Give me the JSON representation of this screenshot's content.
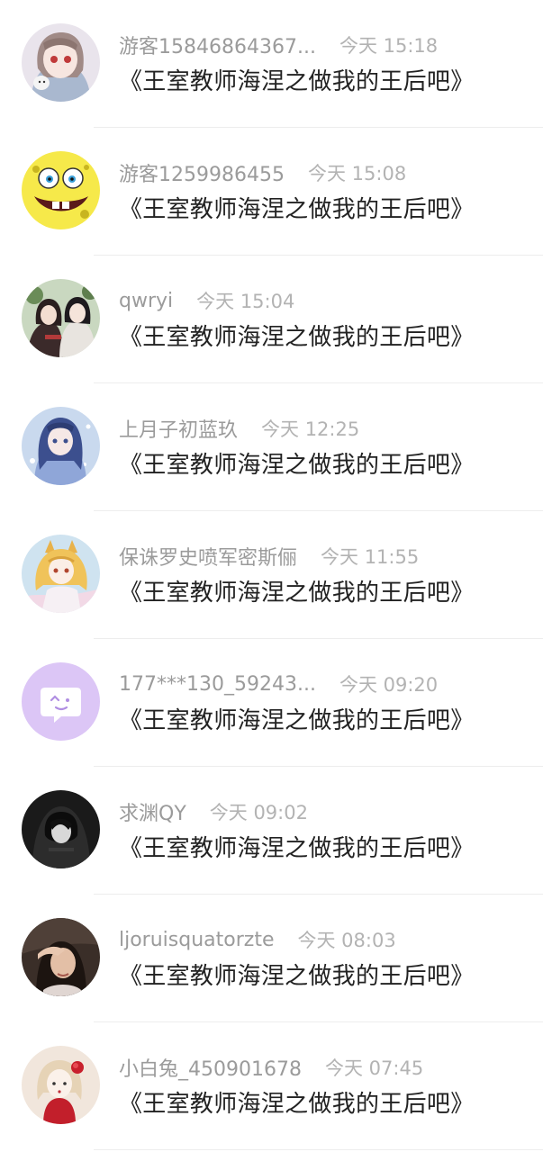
{
  "comments": [
    {
      "username": "游客15846864367...",
      "time": "今天 15:18",
      "content": "《王室教师海涅之做我的王后吧》",
      "avatar_icon": "anime-girl-avatar-icon"
    },
    {
      "username": "游客1259986455",
      "time": "今天 15:08",
      "content": "《王室教师海涅之做我的王后吧》",
      "avatar_icon": "spongebob-avatar-icon"
    },
    {
      "username": "qwryi",
      "time": "今天 15:04",
      "content": "《王室教师海涅之做我的王后吧》",
      "avatar_icon": "two-characters-avatar-icon"
    },
    {
      "username": "上月子初蓝玖",
      "time": "今天 12:25",
      "content": "《王室教师海涅之做我的王后吧》",
      "avatar_icon": "blue-hair-girl-avatar-icon"
    },
    {
      "username": "保诛罗史喷军密斯俪",
      "time": "今天 11:55",
      "content": "《王室教师海涅之做我的王后吧》",
      "avatar_icon": "fox-girl-avatar-icon"
    },
    {
      "username": "177***130_59243...",
      "time": "今天 09:20",
      "content": "《王室教师海涅之做我的王后吧》",
      "avatar_icon": "default-chat-avatar-icon"
    },
    {
      "username": "求渊QY",
      "time": "今天 09:02",
      "content": "《王室教师海涅之做我的王后吧》",
      "avatar_icon": "dark-hood-avatar-icon"
    },
    {
      "username": "ljoruisquatorzte",
      "time": "今天 08:03",
      "content": "《王室教师海涅之做我的王后吧》",
      "avatar_icon": "photo-girl-avatar-icon"
    },
    {
      "username": "小白兔_450901678",
      "time": "今天 07:45",
      "content": "《王室教师海涅之做我的王后吧》",
      "avatar_icon": "rose-girl-avatar-icon"
    }
  ],
  "colors": {
    "username": "#9b9b9b",
    "time": "#b3b3b3",
    "content": "#222222",
    "divider": "#ededed",
    "default_avatar_bg": "#d9c4f3"
  }
}
